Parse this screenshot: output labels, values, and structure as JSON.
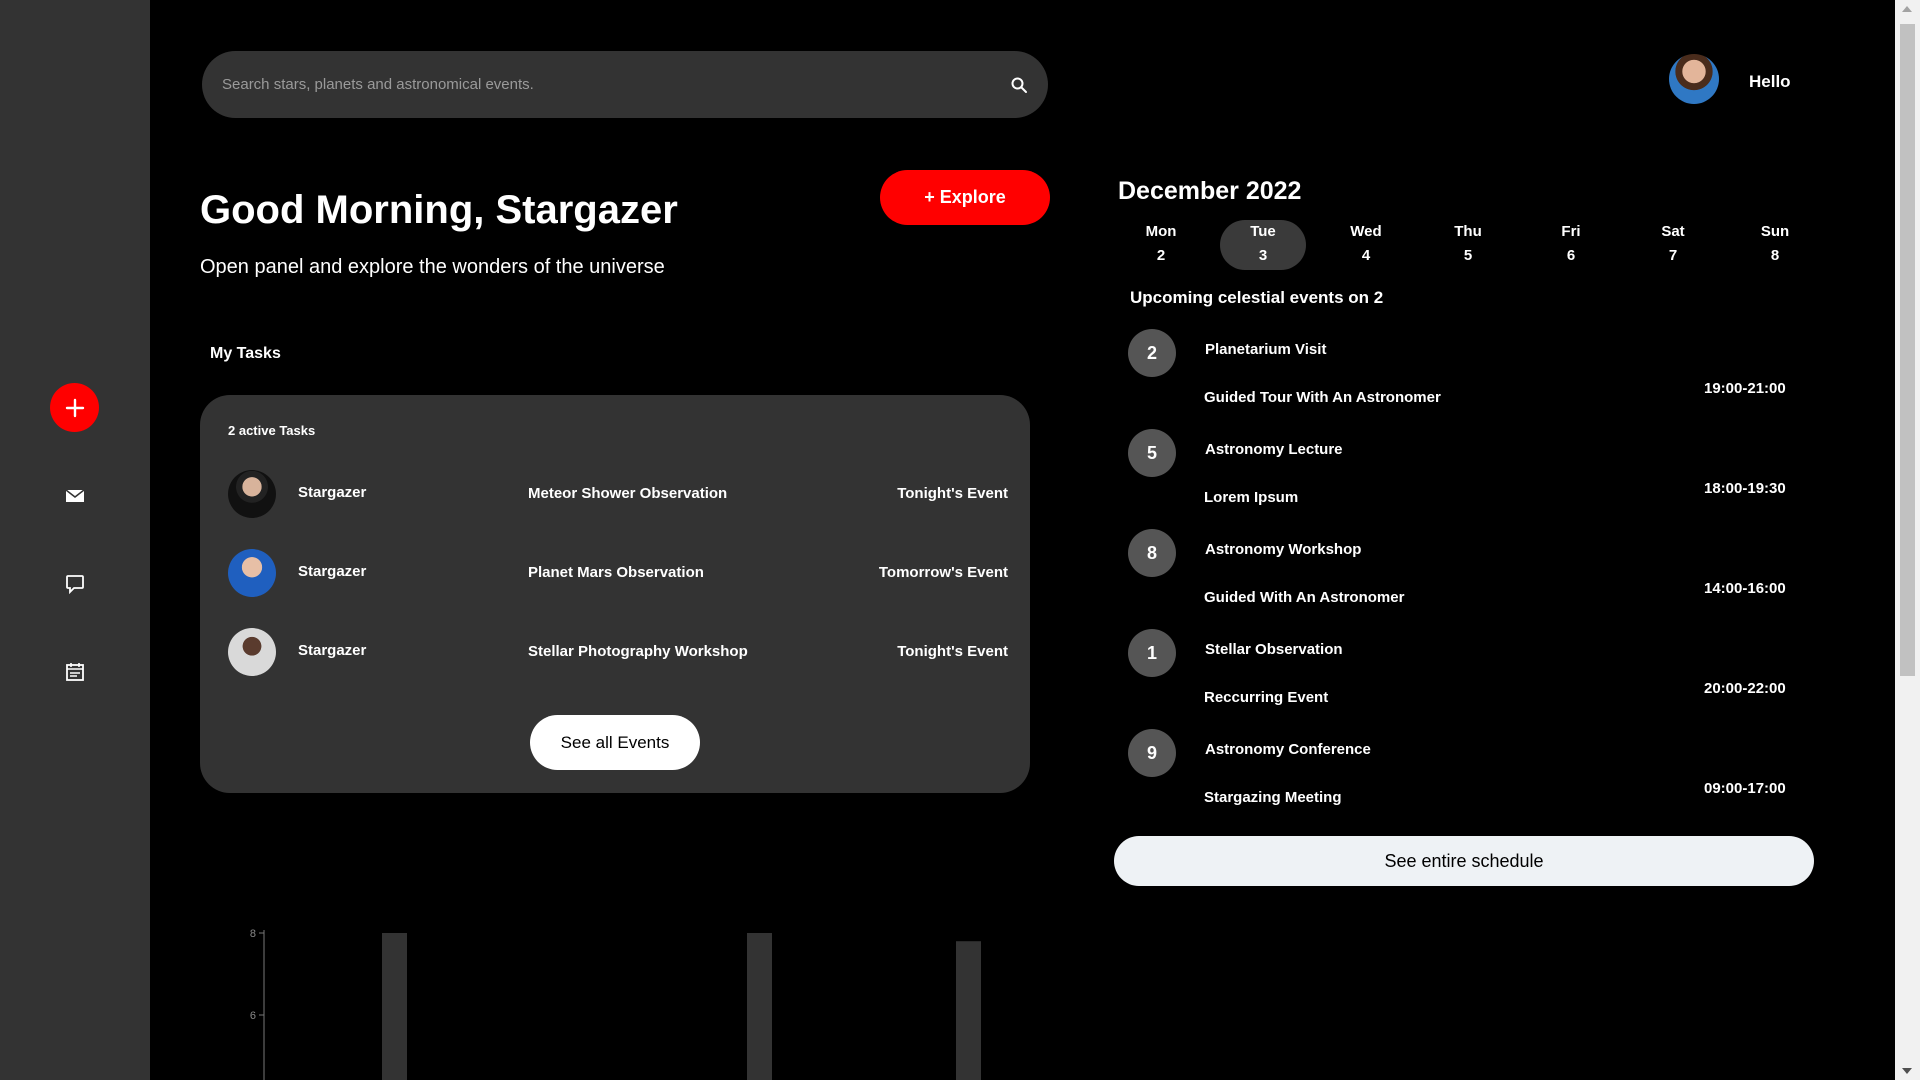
{
  "search": {
    "placeholder": "Search stars, planets and astronomical events."
  },
  "header": {
    "greeting": "Hello"
  },
  "hero": {
    "title": "Good Morning, Stargazer",
    "subtitle": "Open panel and explore the wonders of the universe",
    "explore_label": "+ Explore"
  },
  "tasks": {
    "section_label": "My Tasks",
    "active_label": "2 active Tasks",
    "items": [
      {
        "name": "Stargazer",
        "event": "Meteor Shower Observation",
        "when": "Tonight's Event"
      },
      {
        "name": "Stargazer",
        "event": "Planet Mars Observation",
        "when": "Tomorrow's Event"
      },
      {
        "name": "Stargazer",
        "event": "Stellar Photography Workshop",
        "when": "Tonight's Event"
      }
    ],
    "see_all_label": "See all Events"
  },
  "calendar": {
    "title": "December 2022",
    "days": [
      {
        "name": "Mon",
        "date": "2"
      },
      {
        "name": "Tue",
        "date": "3",
        "selected": true
      },
      {
        "name": "Wed",
        "date": "4"
      },
      {
        "name": "Thu",
        "date": "5"
      },
      {
        "name": "Fri",
        "date": "6"
      },
      {
        "name": "Sat",
        "date": "7"
      },
      {
        "name": "Sun",
        "date": "8"
      }
    ],
    "upcoming_label": "Upcoming celestial events on 2",
    "events": [
      {
        "num": "2",
        "title": "Planetarium Visit",
        "sub": "Guided Tour With An Astronomer",
        "time": "19:00-21:00"
      },
      {
        "num": "5",
        "title": "Astronomy Lecture",
        "sub": "Lorem Ipsum",
        "time": "18:00-19:30"
      },
      {
        "num": "8",
        "title": "Astronomy Workshop",
        "sub": "Guided With An Astronomer",
        "time": "14:00-16:00"
      },
      {
        "num": "1",
        "title": "Stellar Observation",
        "sub": "Reccurring Event",
        "time": "20:00-22:00"
      },
      {
        "num": "9",
        "title": "Astronomy Conference",
        "sub": "Stargazing Meeting",
        "time": "09:00-17:00"
      }
    ],
    "schedule_label": "See entire schedule"
  },
  "colors": {
    "accent": "#ff0000",
    "panel": "#333333",
    "background": "#000000"
  },
  "chart_data": {
    "type": "bar",
    "y_ticks": [
      "8",
      "6"
    ],
    "ylim_visible": [
      5.5,
      8.1
    ],
    "values_visible": [
      8,
      8,
      7.8
    ]
  }
}
